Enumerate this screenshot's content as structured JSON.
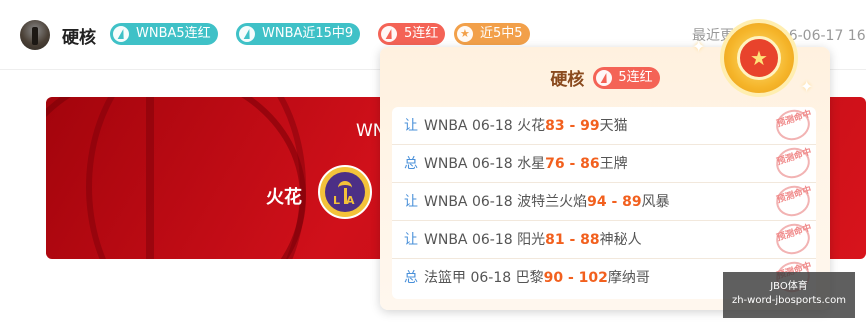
{
  "header": {
    "name": "硬核",
    "tags": [
      {
        "label": "WNBA5连红",
        "color": "#3fc1c7",
        "icon": "flame-icon"
      },
      {
        "label": "WNBA近15中9",
        "color": "#3fc1c7",
        "icon": "flame-icon"
      },
      {
        "label": "5连红",
        "color": "#f46356",
        "icon": "flame-icon"
      },
      {
        "label": "近5中5",
        "color": "#f2a04a",
        "icon": "star-icon"
      }
    ],
    "updated": "最近更新：2026-06-17 16"
  },
  "banner": {
    "title": "WN",
    "team_name": "火花",
    "team_logo_text": "LA"
  },
  "popup": {
    "name": "硬核",
    "tag": "5连红",
    "medal_icon": "★",
    "rows": [
      {
        "type": "让",
        "league": "WNBA",
        "date": "06-18",
        "home": "火花",
        "home_score": "83",
        "sep": " - ",
        "away_score": "99",
        "away": "天猫",
        "stamp": "预测命中"
      },
      {
        "type": "总",
        "league": "WNBA",
        "date": "06-18",
        "home": "水星",
        "home_score": "76",
        "sep": " - ",
        "away_score": "86",
        "away": "王牌",
        "stamp": "预测命中"
      },
      {
        "type": "让",
        "league": "WNBA",
        "date": "06-18",
        "home": "波特兰火焰",
        "home_score": "94",
        "sep": " - ",
        "away_score": "89",
        "away": "风暴",
        "stamp": "预测命中"
      },
      {
        "type": "让",
        "league": "WNBA",
        "date": "06-18",
        "home": "阳光",
        "home_score": "81",
        "sep": " - ",
        "away_score": "88",
        "away": "神秘人",
        "stamp": "预测命中"
      },
      {
        "type": "总",
        "league": "法篮甲",
        "date": "06-18",
        "home": "巴黎",
        "home_score": "90",
        "sep": " - ",
        "away_score": "102",
        "away": "摩纳哥",
        "stamp": "预测命中"
      }
    ]
  },
  "watermark": {
    "line1": "JBO体育",
    "line2": "zh-word-jbosports.com"
  },
  "colors": {
    "accent_teal": "#3fc1c7",
    "accent_red": "#f46356",
    "accent_orange": "#f2a04a",
    "score": "#f2601e",
    "type_label": "#4a90d9"
  }
}
